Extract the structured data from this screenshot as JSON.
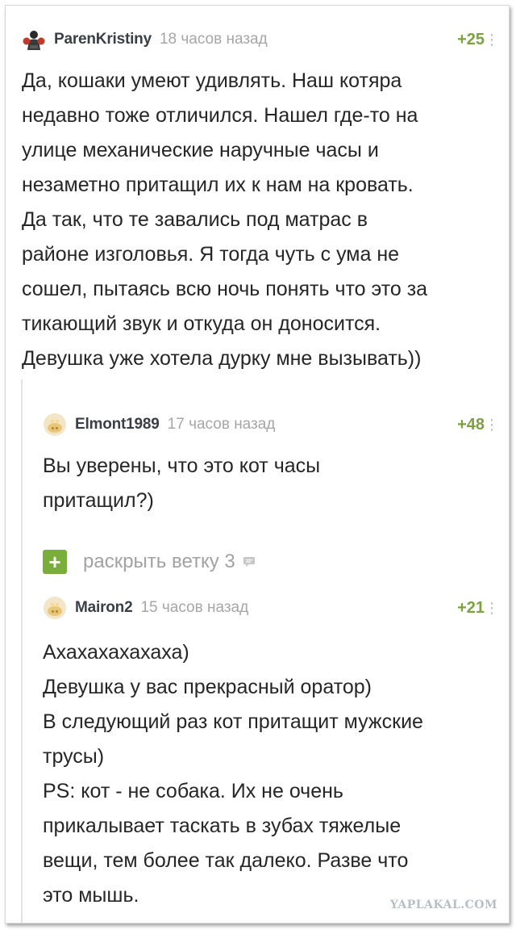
{
  "comments": [
    {
      "author": "ParenKristiny",
      "time": "18 часов назад",
      "rating": "+25",
      "menu_icon": "more-vertical-icon",
      "avatar_icon": "boxer-avatar-icon",
      "text": "Да, кошаки умеют удивлять. Наш котяра\nнедавно тоже отличился. Нашел где-то на\nулице механические наручные часы и\nнезаметно притащил их к нам на кровать.\nДа так, что те завались под матрас в\nрайоне изголовья. Я тогда чуть с ума не\nсошел, пытаясь всю ночь понять что это за\nтикающий звук и откуда он доносится.\nДевушка уже хотела дурку мне вызывать))"
    },
    {
      "author": "Elmont1989",
      "time": "17 часов назад",
      "rating": "+48",
      "menu_icon": "more-vertical-icon",
      "avatar_icon": "default-avatar-icon",
      "text": "Вы уверены, что это кот часы\nпритащил?)"
    },
    {
      "author": "Mairon2",
      "time": "15 часов назад",
      "rating": "+21",
      "menu_icon": "more-vertical-icon",
      "avatar_icon": "default-avatar-icon",
      "text": "Ахахахахахаха)\nДевушка у вас прекрасный оратор)\nВ следующий раз кот притащит мужские\nтрусы)\nPS: кот - не собака. Их не очень\nприкалывает таскать в зубах тяжелые\nвещи, тем более так далеко. Разве что\nэто мышь."
    }
  ],
  "expand_thread": {
    "label": "раскрыть ветку 3",
    "plus_icon": "plus-icon",
    "count_icon": "message-icon"
  },
  "watermark": "YAPLAKAL.COM",
  "colors": {
    "rating": "#7aa23d",
    "plus_button": "#7aae3b",
    "time": "#a6a6a6"
  }
}
